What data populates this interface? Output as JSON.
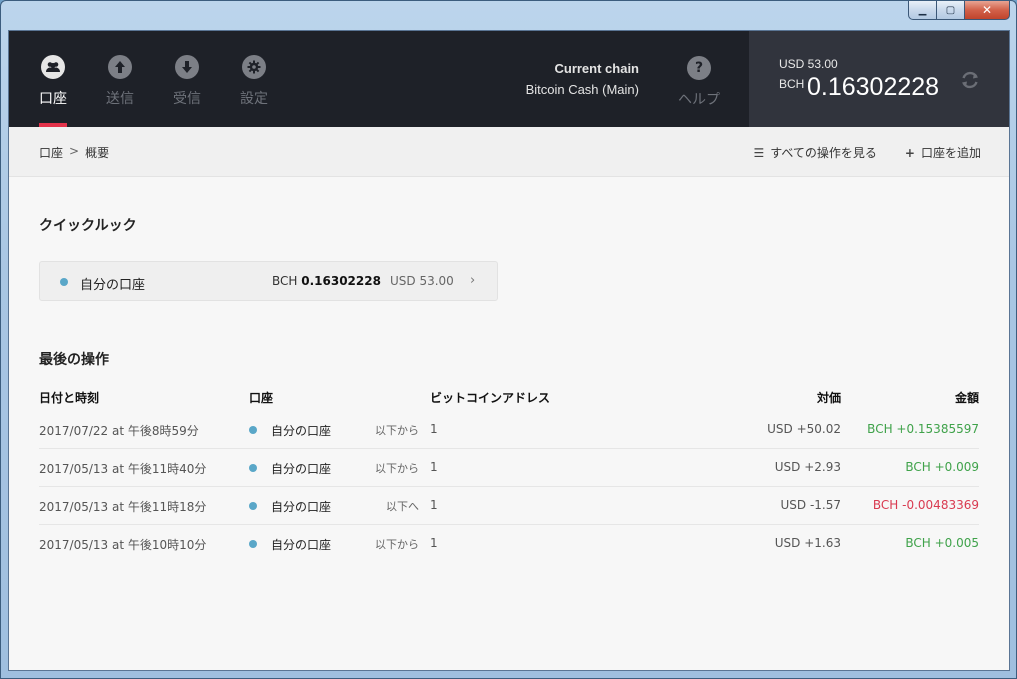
{
  "window": {
    "min_label": "▁",
    "max_label": "▢",
    "close_label": "✕"
  },
  "nav": {
    "items": [
      {
        "label": "口座",
        "icon": "accounts-icon",
        "active": true
      },
      {
        "label": "送信",
        "icon": "send-icon",
        "active": false
      },
      {
        "label": "受信",
        "icon": "receive-icon",
        "active": false
      },
      {
        "label": "設定",
        "icon": "settings-icon",
        "active": false
      }
    ],
    "help_label": "ヘルプ"
  },
  "chain": {
    "title": "Current chain",
    "value": "Bitcoin Cash (Main)"
  },
  "balance": {
    "usd": "USD 53.00",
    "ticker": "BCH",
    "amount": "0.16302228"
  },
  "breadcrumb": {
    "root": "口座",
    "separator": ">",
    "current": "概要"
  },
  "actions": {
    "view_all": "すべての操作を見る",
    "add_account": "口座を追加"
  },
  "quick_look": {
    "title": "クイックルック",
    "account_name": "自分の口座",
    "bch_prefix": "BCH ",
    "bch_value": "0.16302228",
    "usd": "USD 53.00",
    "chevron": "›"
  },
  "last_ops": {
    "title": "最後の操作",
    "headers": {
      "date": "日付と時刻",
      "account": "口座",
      "address": "ビットコインアドレス",
      "countervalue": "対価",
      "amount": "金額"
    },
    "rows": [
      {
        "date": "2017/07/22 at 午後8時59分",
        "account": "自分の口座",
        "direction": "以下から",
        "address": "1",
        "usd": "USD +50.02",
        "bch": "BCH +0.15385597",
        "sign": "pos"
      },
      {
        "date": "2017/05/13 at 午後11時40分",
        "account": "自分の口座",
        "direction": "以下から",
        "address": "1",
        "usd": "USD +2.93",
        "bch": "BCH +0.009",
        "sign": "pos"
      },
      {
        "date": "2017/05/13 at 午後11時18分",
        "account": "自分の口座",
        "direction": "以下へ",
        "address": "1",
        "usd": "USD -1.57",
        "bch": "BCH -0.00483369",
        "sign": "neg"
      },
      {
        "date": "2017/05/13 at 午後10時10分",
        "account": "自分の口座",
        "direction": "以下から",
        "address": "1",
        "usd": "USD +1.63",
        "bch": "BCH +0.005",
        "sign": "pos"
      }
    ]
  },
  "colors": {
    "header_bg": "#1e2128",
    "balance_bg": "#31343d",
    "accent_underline": "#e3324a",
    "account_dot": "#5aa7c8",
    "positive": "#3fa24a",
    "negative": "#d93a50"
  }
}
